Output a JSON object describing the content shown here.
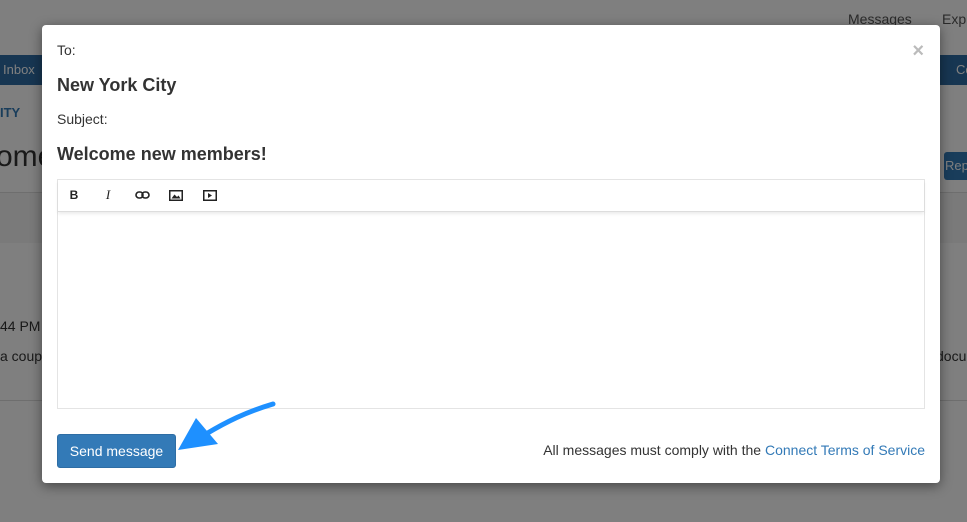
{
  "background": {
    "top_links": [
      "Messages",
      "Exp"
    ],
    "nav_left": "Inbox",
    "nav_right": "Co",
    "breadcrumb": "ITY",
    "title": "ome",
    "button_label": "Rep",
    "time_text": "44 PM",
    "snippet_left": "a coup",
    "snippet_right": "docu"
  },
  "modal": {
    "to_label": "To:",
    "to_value": "New York City",
    "subject_label": "Subject:",
    "subject_value": "Welcome new members!",
    "close_glyph": "×",
    "toolbar": [
      {
        "name": "bold",
        "glyph": "B"
      },
      {
        "name": "italic",
        "glyph": "I"
      },
      {
        "name": "link",
        "glyph": "link-icon"
      },
      {
        "name": "image",
        "glyph": "image-icon"
      },
      {
        "name": "video",
        "glyph": "video-icon"
      }
    ],
    "editor_value": "",
    "send_label": "Send message",
    "terms_text": "All messages must comply with the ",
    "terms_link": "Connect Terms of Service"
  },
  "colors": {
    "primary": "#337ab7",
    "annotation_arrow": "#1e90ff"
  }
}
